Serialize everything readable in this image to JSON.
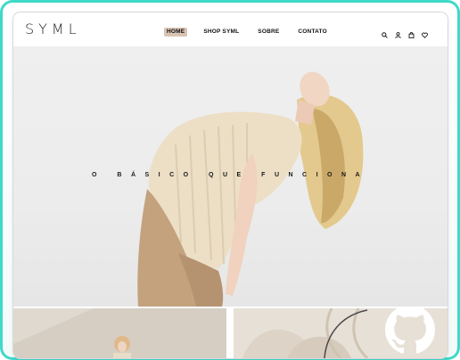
{
  "brand": {
    "logo": "SYML"
  },
  "nav": {
    "items": [
      {
        "label": "HOME",
        "active": true
      },
      {
        "label": "SHOP SYML",
        "active": false
      },
      {
        "label": "SOBRE",
        "active": false
      },
      {
        "label": "CONTATO",
        "active": false
      }
    ],
    "icons": [
      "search-icon",
      "user-icon",
      "bag-icon",
      "heart-icon"
    ]
  },
  "hero": {
    "tagline": "O BÁSICO QUE FUNCIONA"
  },
  "colors": {
    "accent": "#d9c3b2",
    "frame": "#3fd9c9",
    "text": "#111111"
  }
}
